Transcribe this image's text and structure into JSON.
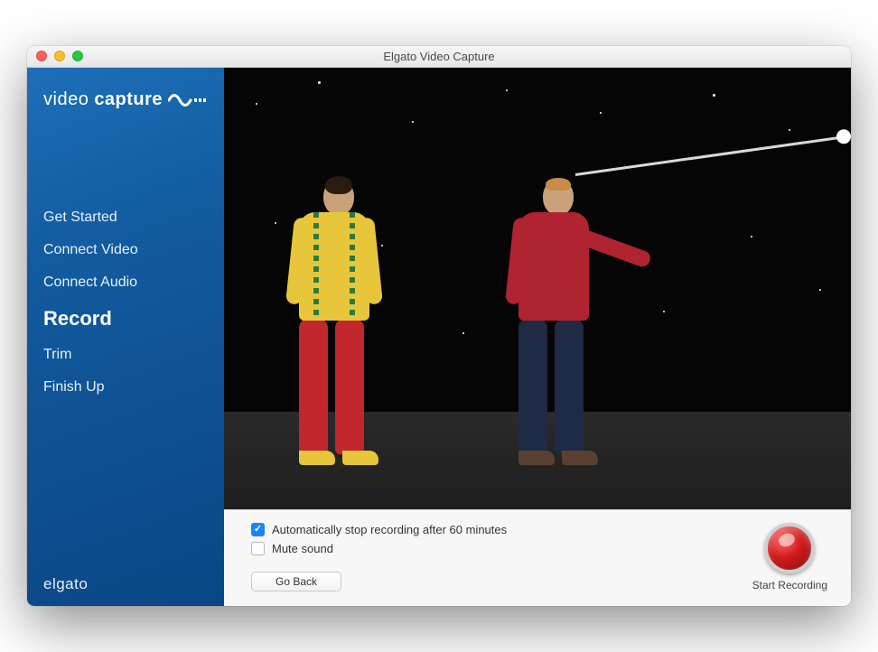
{
  "window": {
    "title": "Elgato Video Capture"
  },
  "sidebar": {
    "logo": {
      "light": "video",
      "bold": "capture"
    },
    "steps": [
      {
        "label": "Get Started",
        "active": false
      },
      {
        "label": "Connect Video",
        "active": false
      },
      {
        "label": "Connect Audio",
        "active": false
      },
      {
        "label": "Record",
        "active": true
      },
      {
        "label": "Trim",
        "active": false
      },
      {
        "label": "Finish Up",
        "active": false
      }
    ],
    "brand": "elgato"
  },
  "controls": {
    "auto_stop": {
      "checked": true,
      "label": "Automatically stop recording after 60 minutes"
    },
    "mute": {
      "checked": false,
      "label": "Mute sound"
    },
    "go_back": "Go Back",
    "record_label": "Start Recording"
  }
}
